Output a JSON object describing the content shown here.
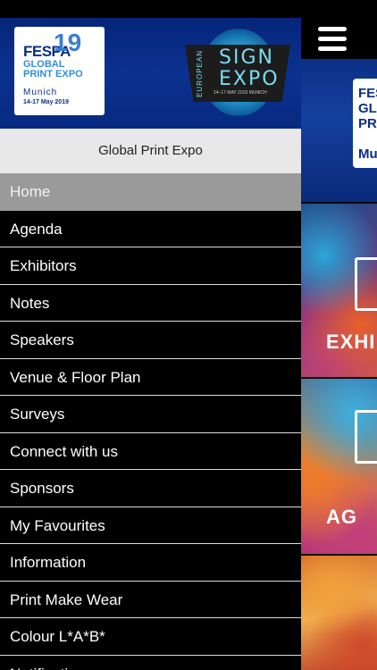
{
  "header": {
    "menu_icon": "hamburger-icon"
  },
  "drawer": {
    "fespa_logo": {
      "word": "FESPA",
      "number": "19",
      "line1": "GLOBAL",
      "line2": "PRINT EXPO",
      "city": "Munich",
      "dates": "14-17 May 2019"
    },
    "sign_logo": {
      "europe": "EUROPEAN",
      "word1": "SIGN",
      "word2": "EXPO",
      "dates": "14–17 MAY 2019 MUNICH"
    },
    "subtitle": "Global Print Expo",
    "items": [
      {
        "label": "Home"
      },
      {
        "label": "Agenda"
      },
      {
        "label": "Exhibitors"
      },
      {
        "label": "Notes"
      },
      {
        "label": "Speakers"
      },
      {
        "label": "Venue & Floor Plan"
      },
      {
        "label": "Surveys"
      },
      {
        "label": "Connect with us"
      },
      {
        "label": "Sponsors"
      },
      {
        "label": "My Favourites"
      },
      {
        "label": "Information"
      },
      {
        "label": "Print Make Wear"
      },
      {
        "label": "Colour L*A*B*"
      },
      {
        "label": "Notifications"
      }
    ]
  },
  "background": {
    "banner_text": "FESPA GLO PRI Mu",
    "tiles": [
      {
        "label": "EXHI"
      },
      {
        "label": "AG"
      }
    ]
  },
  "colors": {
    "drawer_banner": "#0b318f",
    "active_item": "#9a9a9a",
    "subtitle_bg": "#e8e8e8"
  }
}
